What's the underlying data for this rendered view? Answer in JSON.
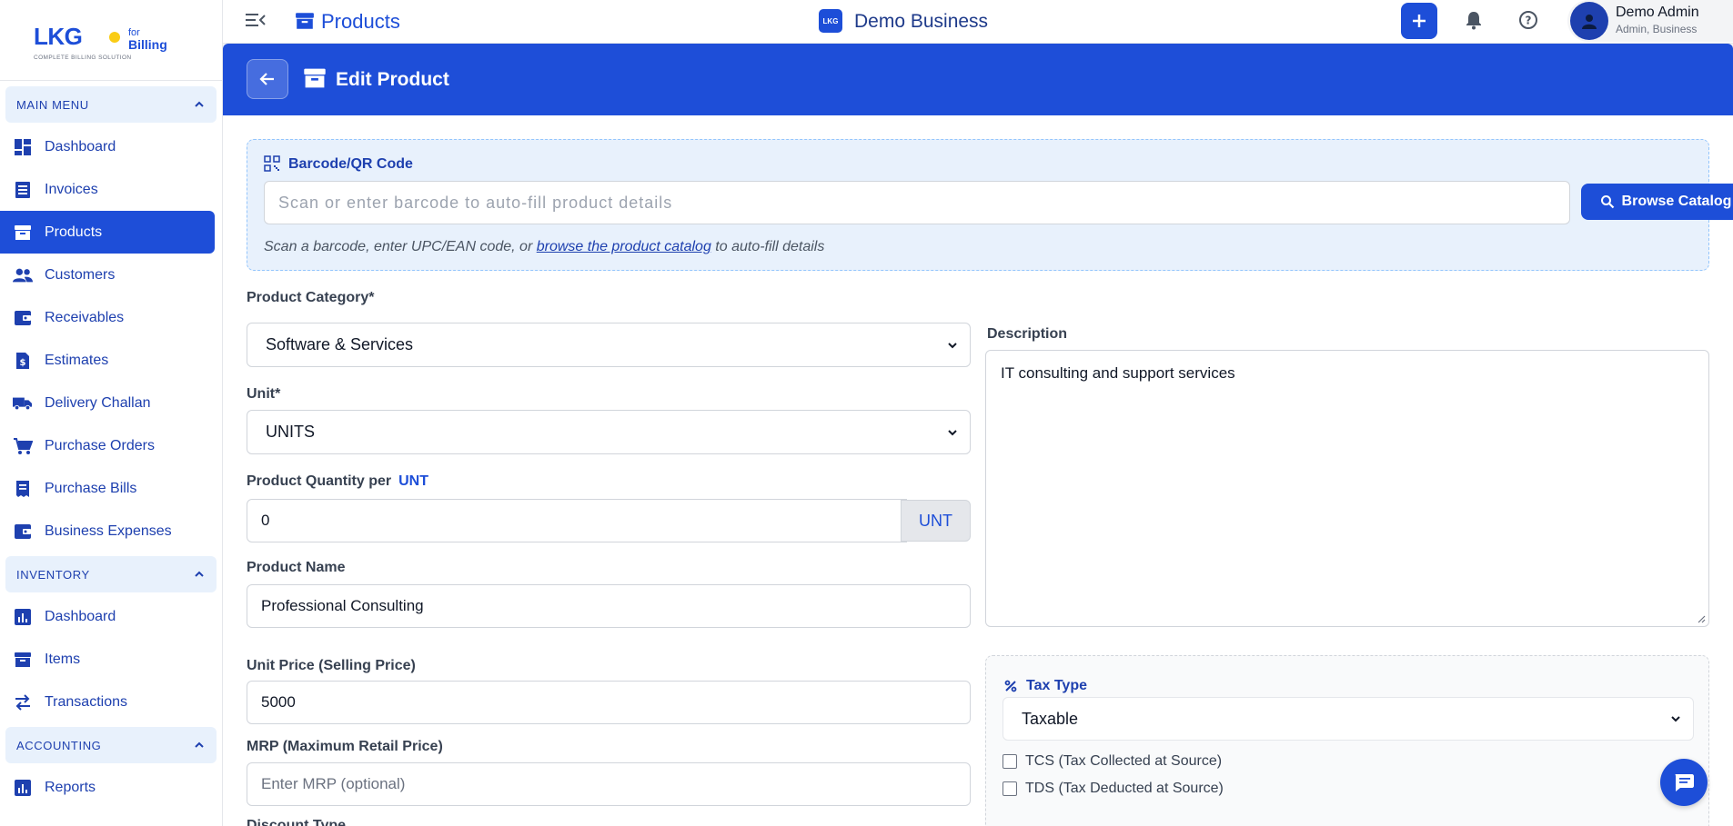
{
  "brand": {
    "logo_main": "LKG",
    "logo_for": "for",
    "logo_billing": "Billing",
    "tagline": "COMPLETE BILLING SOLUTION",
    "accent": "#1e4ed8"
  },
  "sidebar": {
    "sections": [
      {
        "title": "MAIN MENU",
        "items": [
          {
            "label": "Dashboard",
            "icon": "dashboard-icon"
          },
          {
            "label": "Invoices",
            "icon": "invoice-icon"
          },
          {
            "label": "Products",
            "icon": "archive-box-icon",
            "active": true
          },
          {
            "label": "Customers",
            "icon": "people-icon"
          },
          {
            "label": "Receivables",
            "icon": "wallet-icon"
          },
          {
            "label": "Estimates",
            "icon": "dollar-file-icon"
          },
          {
            "label": "Delivery Challan",
            "icon": "truck-icon"
          },
          {
            "label": "Purchase Orders",
            "icon": "cart-icon"
          },
          {
            "label": "Purchase Bills",
            "icon": "receipt-icon"
          },
          {
            "label": "Business Expenses",
            "icon": "wallet-icon"
          }
        ]
      },
      {
        "title": "INVENTORY",
        "items": [
          {
            "label": "Dashboard",
            "icon": "bar-chart-icon"
          },
          {
            "label": "Items",
            "icon": "archive-box-icon"
          },
          {
            "label": "Transactions",
            "icon": "swap-arrows-icon"
          }
        ]
      },
      {
        "title": "ACCOUNTING",
        "items": [
          {
            "label": "Reports",
            "icon": "bar-chart-icon"
          }
        ]
      }
    ]
  },
  "topbar": {
    "page_title": "Products",
    "business_logo": "LKG",
    "business_name": "Demo Business",
    "user_name": "Demo Admin",
    "user_role": "Admin, Business"
  },
  "header": {
    "title": "Edit Product"
  },
  "barcode": {
    "title": "Barcode/QR Code",
    "placeholder": "Scan or enter barcode to auto-fill product details",
    "browse_label": "Browse Catalog",
    "hint_before": "Scan a barcode, enter UPC/EAN code, or ",
    "hint_link": "browse the product catalog",
    "hint_after": " to auto-fill details"
  },
  "form": {
    "category_label": "Product Category*",
    "category_value": "Software & Services",
    "unit_label": "Unit*",
    "unit_value": "UNITS",
    "qty_label": "Product Quantity per",
    "qty_unit": "UNT",
    "qty_value": "0",
    "name_label": "Product Name",
    "name_value": "Professional Consulting",
    "price_label": "Unit Price (Selling Price)",
    "price_value": "5000",
    "mrp_label": "MRP (Maximum Retail Price)",
    "mrp_placeholder": "Enter MRP (optional)",
    "discount_label": "Discount Type",
    "description_label": "Description",
    "description_value": "IT consulting and support services"
  },
  "tax": {
    "title": "Tax Type",
    "value": "Taxable",
    "tcs_label": "TCS (Tax Collected at Source)",
    "tds_label": "TDS (Tax Deducted at Source)"
  }
}
